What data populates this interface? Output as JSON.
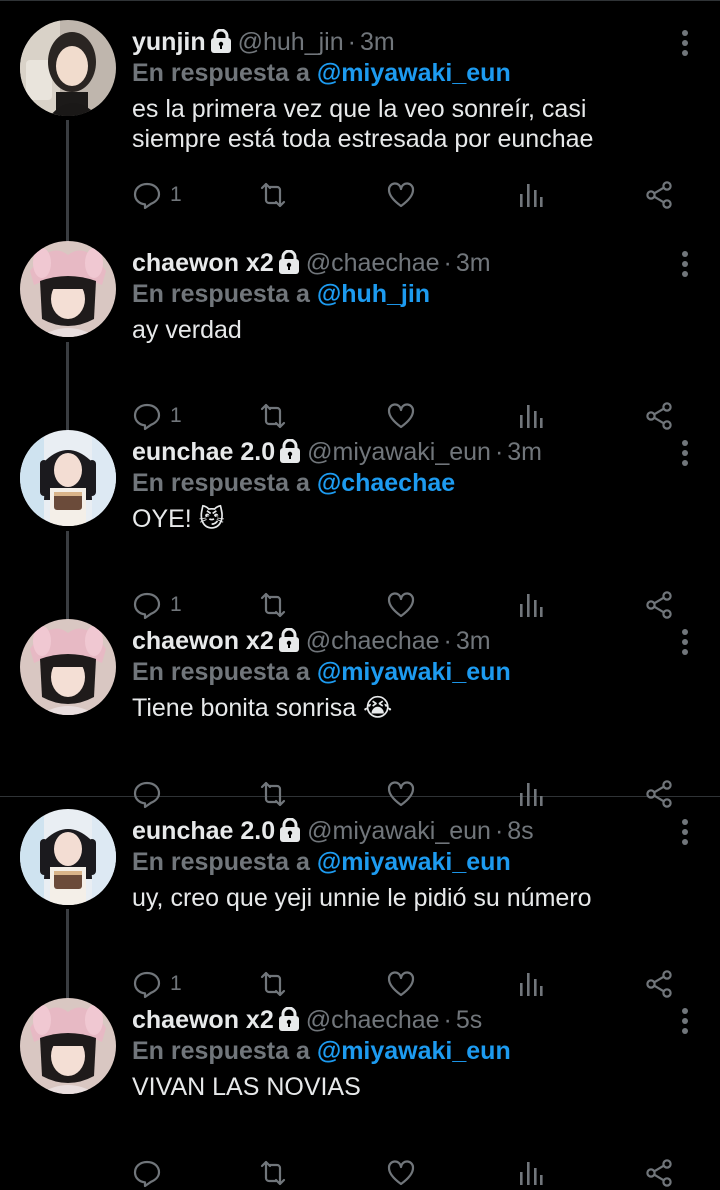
{
  "reply_prefix": "En respuesta a",
  "colors": {
    "background": "#000000",
    "mention": "#1d9bf0",
    "muted": "#71767b",
    "text": "#e7e9ea"
  },
  "tweets": [
    {
      "name": "yunjin",
      "handle": "@huh_jin",
      "time": "3m",
      "reply_to": "@miyawaki_eun",
      "text": "es la primera vez que la veo sonreír, casi siempre está toda estresada por eunchae",
      "reply_count": "1",
      "avatar": "avatar-yunjin"
    },
    {
      "name": "chaewon x2",
      "handle": "@chaechae",
      "time": "3m",
      "reply_to": "@huh_jin",
      "text": "ay verdad",
      "reply_count": "1",
      "avatar": "avatar-chaewon"
    },
    {
      "name": "eunchae 2.0",
      "handle": "@miyawaki_eun",
      "time": "3m",
      "reply_to": "@chaechae",
      "text": "OYE! 😼",
      "reply_count": "1",
      "avatar": "avatar-eunchae"
    },
    {
      "name": "chaewon x2",
      "handle": "@chaechae",
      "time": "3m",
      "reply_to": "@miyawaki_eun",
      "text": "Tiene bonita sonrisa 😭",
      "reply_count": "",
      "avatar": "avatar-chaewon"
    },
    {
      "name": "eunchae 2.0",
      "handle": "@miyawaki_eun",
      "time": "8s",
      "reply_to": "@miyawaki_eun",
      "text": "uy, creo que yeji unnie le pidió su número",
      "reply_count": "1",
      "avatar": "avatar-eunchae"
    },
    {
      "name": "chaewon x2",
      "handle": "@chaechae",
      "time": "5s",
      "reply_to": "@miyawaki_eun",
      "text": "VIVAN LAS NOVIAS",
      "reply_count": "",
      "avatar": "avatar-chaewon"
    }
  ]
}
